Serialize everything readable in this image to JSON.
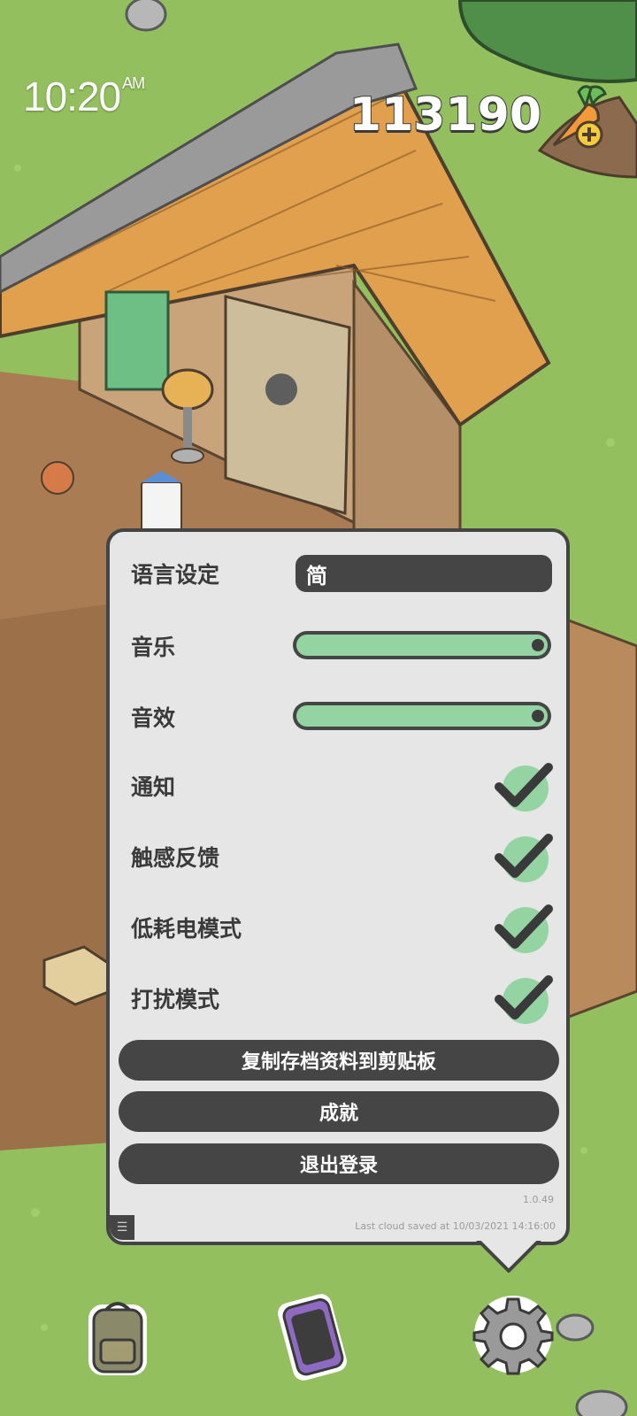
{
  "status_bar": {
    "time": "10:20",
    "ampm": "AM"
  },
  "currency": {
    "amount": "113190",
    "icon": "carrot-plus-icon"
  },
  "settings": {
    "language": {
      "label": "语言设定",
      "value": "简"
    },
    "music": {
      "label": "音乐",
      "level": 1.0
    },
    "sfx": {
      "label": "音效",
      "level": 1.0
    },
    "toggles": [
      {
        "label": "通知",
        "checked": true
      },
      {
        "label": "触感反馈",
        "checked": true
      },
      {
        "label": "低耗电模式",
        "checked": true
      },
      {
        "label": "打扰模式",
        "checked": true
      }
    ],
    "buttons": {
      "copy_save": "复制存档资料到剪贴板",
      "achievements": "成就",
      "logout": "退出登录"
    },
    "version": "1.0.49",
    "last_saved": "Last cloud saved at 10/03/2021 14:16:00"
  },
  "dock": [
    "backpack-icon",
    "phone-icon",
    "gear-icon"
  ],
  "colors": {
    "accent": "#94d3a2",
    "dark": "#454545",
    "panel": "#e6e6e6",
    "grass": "#93bf5f"
  }
}
